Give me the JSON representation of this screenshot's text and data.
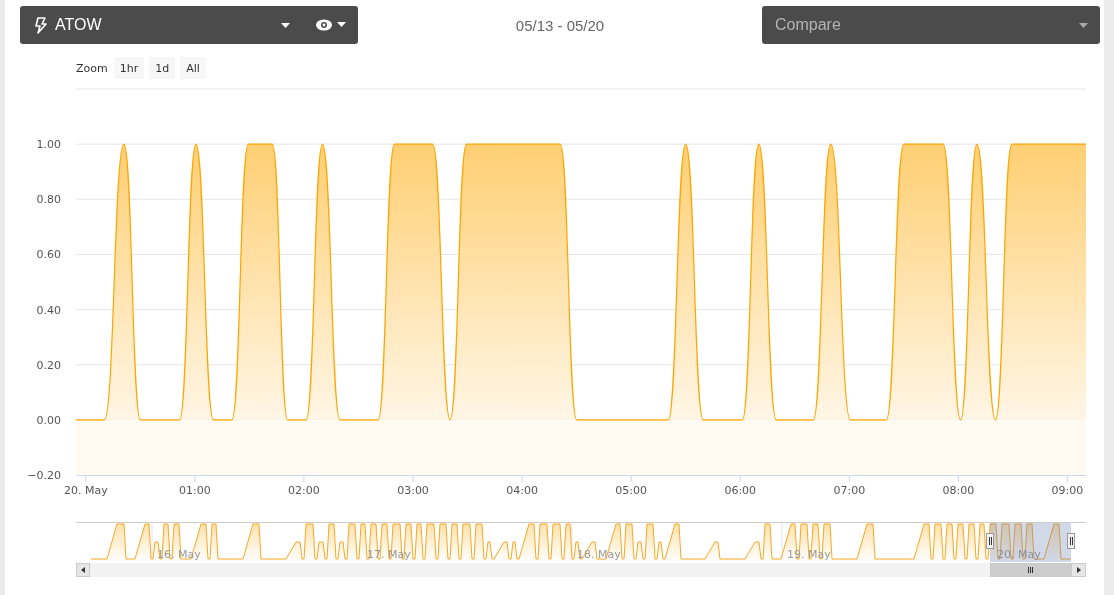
{
  "selector": {
    "label": "ATOW"
  },
  "date_range": "05/13 - 05/20",
  "compare": {
    "placeholder": "Compare"
  },
  "zoom": {
    "label": "Zoom",
    "buttons": [
      {
        "label": "1hr",
        "selected": false
      },
      {
        "label": "1d",
        "selected": false
      },
      {
        "label": "All",
        "selected": false
      }
    ]
  },
  "chart": {
    "chart_data": {
      "type": "area",
      "grid": true,
      "xlim": [
        -0.09,
        9.17
      ],
      "ylim": [
        -0.2,
        1.2
      ],
      "x": [
        -0.09,
        0.17,
        0.35,
        0.5,
        0.86,
        1.01,
        1.17,
        1.34,
        1.49,
        1.71,
        1.85,
        2.02,
        2.17,
        2.33,
        2.68,
        2.83,
        3.18,
        3.34,
        3.49,
        4.35,
        4.5,
        5.34,
        5.5,
        5.66,
        6.02,
        6.17,
        6.33,
        6.67,
        6.83,
        7.01,
        7.34,
        7.5,
        7.86,
        8.02,
        8.17,
        8.34,
        8.49,
        9.17
      ],
      "series": [
        {
          "color": "#ffa500",
          "values": [
            0,
            0,
            1,
            0,
            0,
            1,
            0,
            0,
            1,
            1,
            0,
            0,
            1,
            0,
            0,
            1,
            1,
            0,
            1,
            1,
            0,
            0,
            1,
            0,
            0,
            1,
            0,
            0,
            1,
            0,
            0,
            1,
            1,
            0,
            1,
            0,
            1,
            1
          ]
        }
      ],
      "xticks": [
        {
          "value": 0,
          "label": "20. May"
        },
        {
          "value": 1,
          "label": "01:00"
        },
        {
          "value": 2,
          "label": "02:00"
        },
        {
          "value": 3,
          "label": "03:00"
        },
        {
          "value": 4,
          "label": "04:00"
        },
        {
          "value": 5,
          "label": "05:00"
        },
        {
          "value": 6,
          "label": "06:00"
        },
        {
          "value": 7,
          "label": "07:00"
        },
        {
          "value": 8,
          "label": "08:00"
        },
        {
          "value": 9,
          "label": "09:00"
        }
      ],
      "yticks": [
        {
          "value": -0.2,
          "label": "−0.20"
        },
        {
          "value": 0,
          "label": "0.00"
        },
        {
          "value": 0.2,
          "label": "0.20"
        },
        {
          "value": 0.4,
          "label": "0.40"
        },
        {
          "value": 0.6,
          "label": "0.60"
        },
        {
          "value": 0.8,
          "label": "0.80"
        },
        {
          "value": 1,
          "label": "1.00"
        }
      ]
    }
  },
  "navigator": {
    "labels": [
      "16. May",
      "17. May",
      "18. May",
      "19. May",
      "20. May"
    ]
  }
}
